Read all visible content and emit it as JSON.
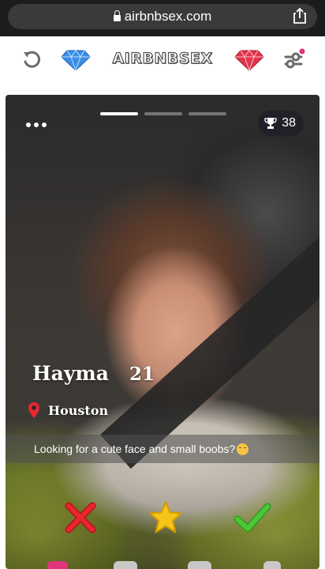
{
  "browser": {
    "url": "airbnbsex.com",
    "icons": {
      "lock": "lock-icon",
      "share": "share-icon"
    }
  },
  "header": {
    "logo_text": "AIRBNBSEX",
    "icons": {
      "rewind": "rewind-icon",
      "blue_gem": "blue-diamond-icon",
      "red_gem": "red-diamond-icon",
      "settings": "filter-settings-icon"
    },
    "colors": {
      "blue_gem": "#3a8ee6",
      "red_gem": "#e0354b",
      "notification_dot": "#e0357a"
    }
  },
  "profile": {
    "name": "Hayma",
    "age": "21",
    "location": "Houston",
    "bio": "Looking for a cute face and small boobs?",
    "trophy_count": "38",
    "photo_count": 3,
    "active_photo": 1
  },
  "actions": {
    "pass": "close-x-icon",
    "super_like": "star-icon",
    "like": "checkmark-icon",
    "colors": {
      "pass": "#e8262f",
      "super_like": "#f5c518",
      "like": "#4cc736"
    }
  }
}
